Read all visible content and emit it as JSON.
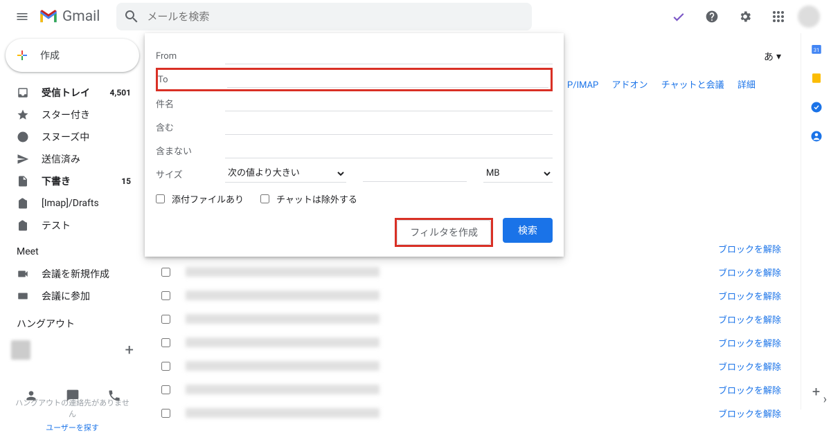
{
  "header": {
    "logo_text": "Gmail",
    "search_placeholder": "メールを検索"
  },
  "compose_label": "作成",
  "nav": [
    {
      "icon": "inbox",
      "label": "受信トレイ",
      "count": "4,501",
      "bold": true
    },
    {
      "icon": "star",
      "label": "スター付き"
    },
    {
      "icon": "clock",
      "label": "スヌーズ中"
    },
    {
      "icon": "send",
      "label": "送信済み"
    },
    {
      "icon": "draft",
      "label": "下書き",
      "count": "15",
      "bold": true
    },
    {
      "icon": "label",
      "label": "[Imap]/Drafts"
    },
    {
      "icon": "label",
      "label": "テスト"
    }
  ],
  "meet": {
    "title": "Meet",
    "new": "会議を新規作成",
    "join": "会議に参加"
  },
  "hangout": {
    "title": "ハングアウト",
    "empty": "ハングアウトの連絡先がありません",
    "find": "ユーザーを探す"
  },
  "settings_tabs": [
    "P/IMAP",
    "アドオン",
    "チャットと会議",
    "詳細"
  ],
  "lang_btn": "あ",
  "blocked_unblock": "ブロックを解除",
  "blocked_count": 8,
  "panel": {
    "from": "From",
    "to": "To",
    "to_value": "",
    "subject": "件名",
    "has": "含む",
    "nothas": "含まない",
    "size": "サイズ",
    "size_op": "次の値より大きい",
    "size_unit": "MB",
    "has_attach": "添付ファイルあり",
    "exclude_chats": "チャットは除外する",
    "create_filter": "フィルタを作成",
    "search": "検索"
  }
}
